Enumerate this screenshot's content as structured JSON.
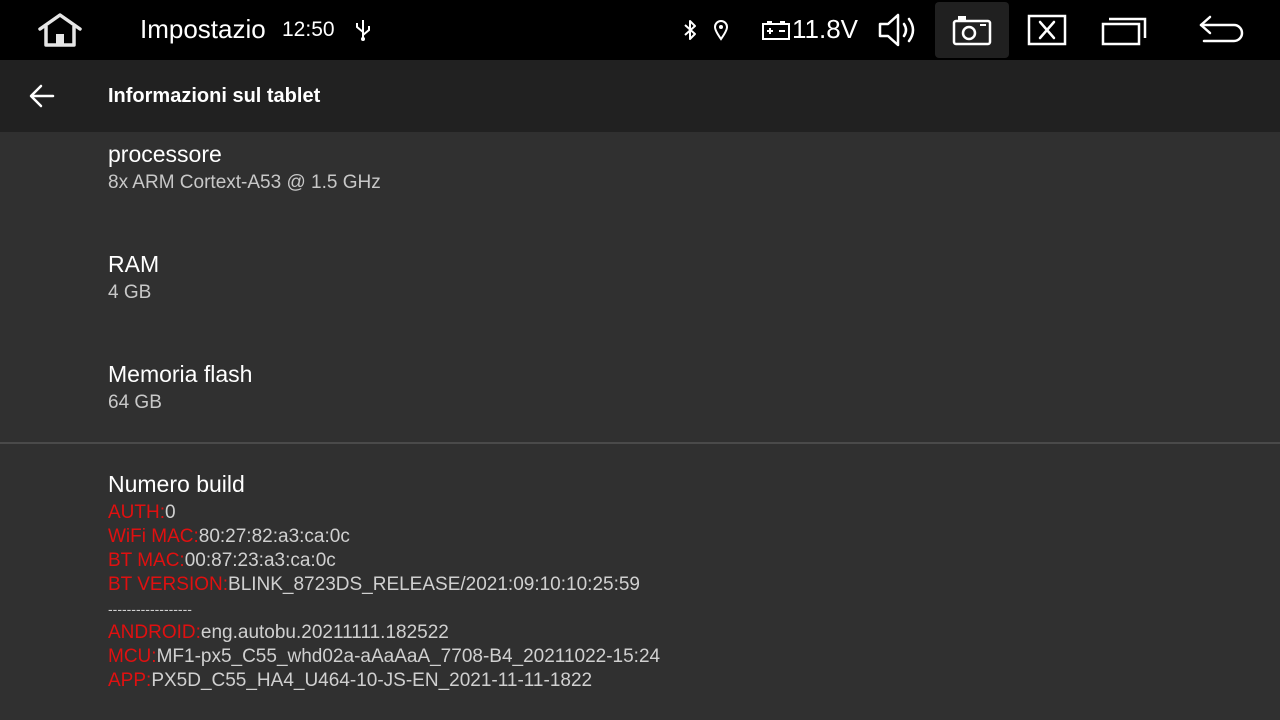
{
  "status_bar": {
    "app_title": "Impostazio",
    "clock": "12:50",
    "voltage": "11.8V",
    "icons": [
      "home-icon",
      "usb-icon",
      "bluetooth-icon",
      "location-icon",
      "battery-icon",
      "volume-icon",
      "camera-icon",
      "close-icon",
      "recents-icon",
      "back-icon"
    ]
  },
  "action_bar": {
    "title": "Informazioni sul tablet"
  },
  "prefs": {
    "processor": {
      "title": "processore",
      "summary": "8x ARM Cortext-A53 @ 1.5 GHz"
    },
    "ram": {
      "title": "RAM",
      "summary": "4 GB"
    },
    "flash": {
      "title": "Memoria flash",
      "summary": "64 GB"
    },
    "build": {
      "title": "Numero build",
      "lines": [
        {
          "key": "AUTH:",
          "value": "0"
        },
        {
          "key": "WiFi MAC:",
          "value": "80:27:82:a3:ca:0c"
        },
        {
          "key": "BT MAC:",
          "value": "00:87:23:a3:ca:0c"
        },
        {
          "key": "BT VERSION:",
          "value": "BLINK_8723DS_RELEASE/2021:09:10:10:25:59"
        }
      ],
      "separator": "------------------",
      "lines2": [
        {
          "key": "ANDROID:",
          "value": "eng.autobu.20211111.182522"
        },
        {
          "key": "MCU:",
          "value": "MF1-px5_C55_whd02a-aAaAaA_7708-B4_20211022-15:24"
        },
        {
          "key": "APP:",
          "value": "PX5D_C55_HA4_U464-10-JS-EN_2021-11-11-1822"
        }
      ]
    }
  },
  "colors": {
    "status_bar_bg": "#000000",
    "action_bar_bg": "#212121",
    "content_bg": "#303030",
    "build_key": "#e01010"
  }
}
